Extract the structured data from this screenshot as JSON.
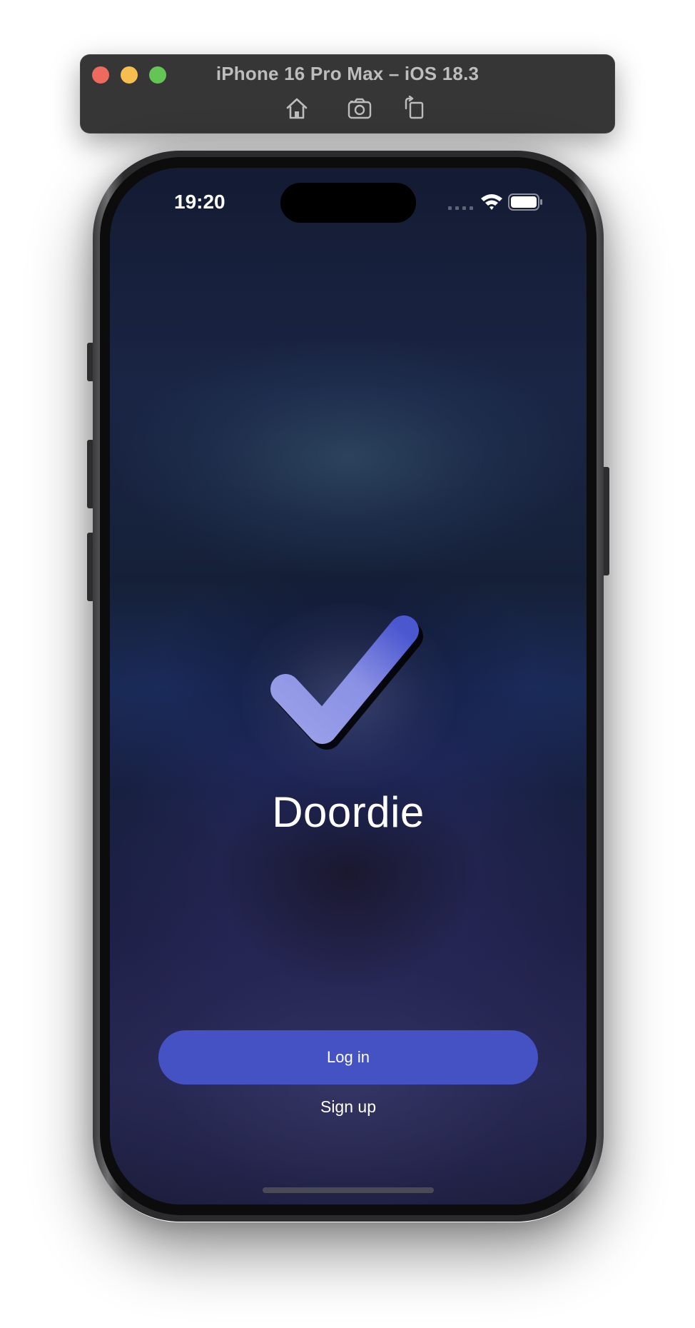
{
  "simulator": {
    "title": "iPhone 16 Pro Max – iOS 18.3",
    "toolbar": {
      "home_icon": "home-icon",
      "screenshot_icon": "camera-icon",
      "rotate_icon": "rotate-icon"
    },
    "traffic_lights": [
      "#ee6a5f",
      "#f5be4f",
      "#62c554"
    ]
  },
  "status_bar": {
    "time": "19:20",
    "icons": [
      "signal-icon",
      "wifi-icon",
      "battery-icon"
    ]
  },
  "app": {
    "logo_icon": "checkmark-icon",
    "title": "Doordie",
    "login_label": "Log in",
    "signup_label": "Sign up",
    "colors": {
      "accent": "#4452c4",
      "background": "#151c35",
      "checkmark_light": "#9aa0e8",
      "checkmark_dark": "#4a57cf"
    }
  }
}
